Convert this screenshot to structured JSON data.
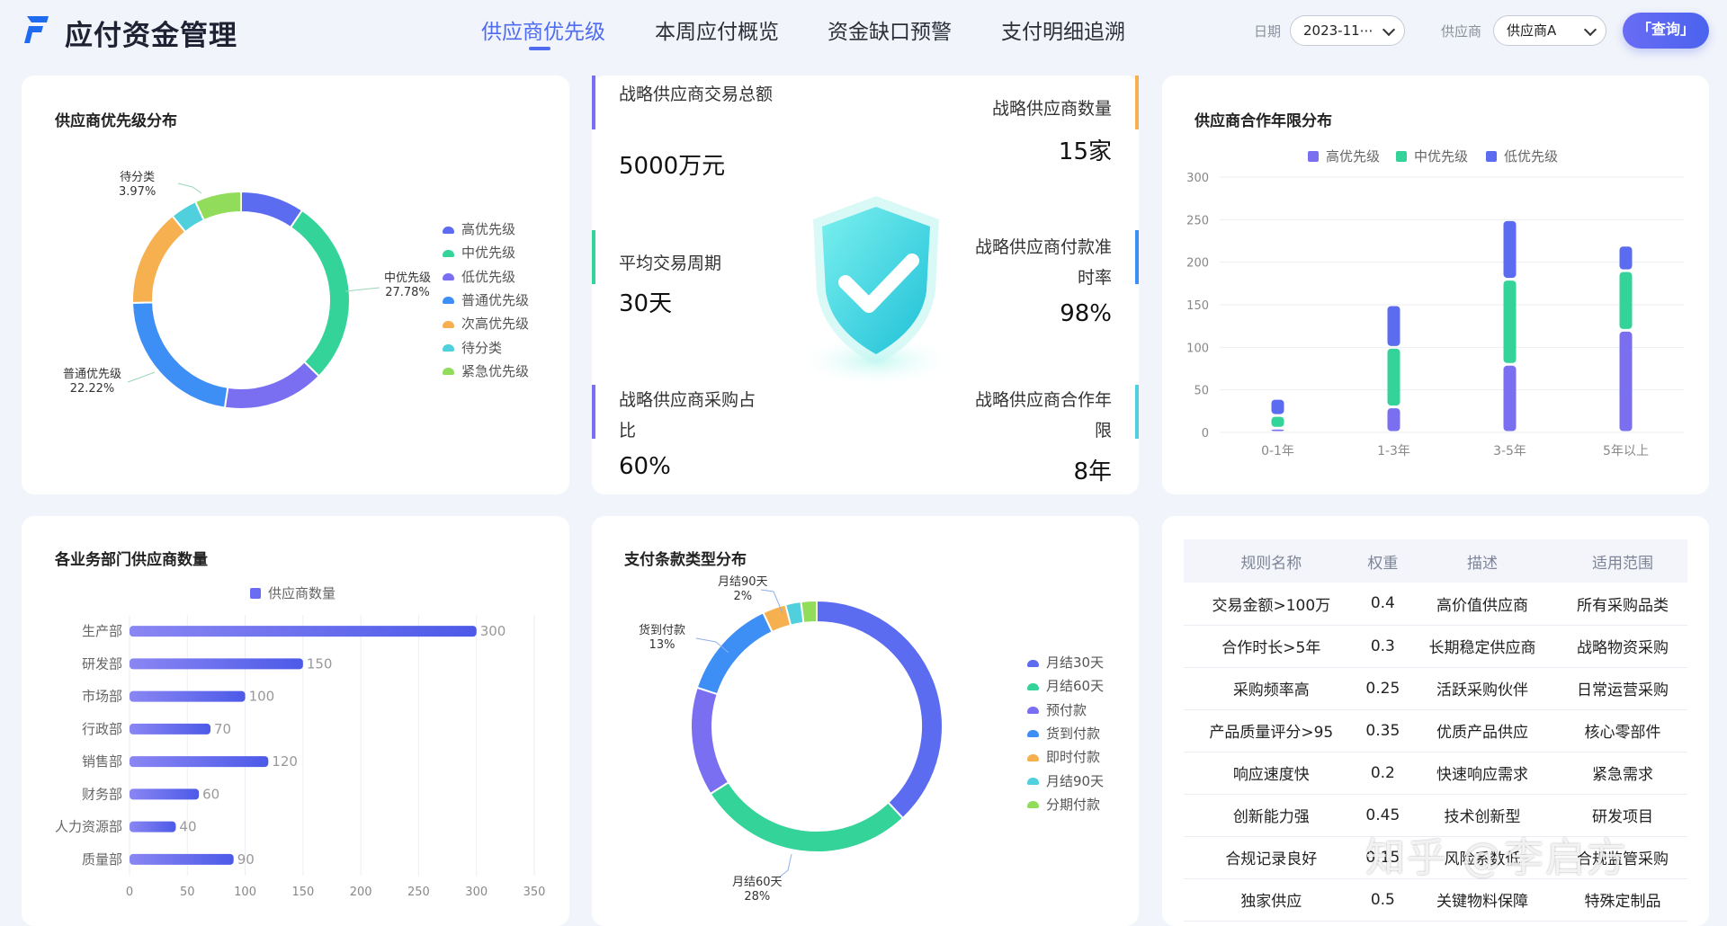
{
  "app": {
    "title": "应付资金管理"
  },
  "nav": {
    "tabs": [
      "供应商优先级",
      "本周应付概览",
      "资金缺口预警",
      "支付明细追溯"
    ],
    "active": 0
  },
  "filters": {
    "date_label": "日期",
    "date_value": "2023-11⋯",
    "supplier_label": "供应商",
    "supplier_value": "供应商A",
    "query_label": "「查询」"
  },
  "colors": {
    "accent": "#4f6bf0",
    "blue": "#5b6cf1",
    "green": "#34d399",
    "purple": "#7b6ff1",
    "lightblue": "#3d8ef5",
    "orange": "#f7b04f",
    "cyan": "#4fd0dc",
    "lime": "#92dc5c"
  },
  "priority_chart": {
    "title": "供应商优先级分布",
    "legend": [
      "高优先级",
      "中优先级",
      "低优先级",
      "普通优先级",
      "次高优先级",
      "待分类",
      "紧急优先级"
    ],
    "slice_labels": [
      {
        "name": "待分类",
        "pct": "3.97%"
      },
      {
        "name": "中优先级",
        "pct": "27.78%"
      },
      {
        "name": "普通优先级",
        "pct": "22.22%"
      }
    ]
  },
  "kpis": [
    {
      "label": "战略供应商交易总额",
      "value": "5000万元"
    },
    {
      "label": "战略供应商数量",
      "value": "15家"
    },
    {
      "label": "平均交易周期",
      "value": "30天"
    },
    {
      "label": "战略供应商付款准时率",
      "value": "98%"
    },
    {
      "label": "战略供应商采购占比",
      "value": "60%"
    },
    {
      "label": "战略供应商合作年限",
      "value": "8年"
    }
  ],
  "coop_chart": {
    "title": "供应商合作年限分布"
  },
  "dept_chart": {
    "title": "各业务部门供应商数量"
  },
  "terms_chart": {
    "title": "支付条款类型分布",
    "legend": [
      "月结30天",
      "月结60天",
      "预付款",
      "货到付款",
      "即时付款",
      "月结90天",
      "分期付款"
    ],
    "slice_labels": [
      {
        "name": "月结90天",
        "pct": "2%"
      },
      {
        "name": "货到付款",
        "pct": "13%"
      },
      {
        "name": "月结60天",
        "pct": "28%"
      }
    ]
  },
  "rules_table": {
    "headers": [
      "规则名称",
      "权重",
      "描述",
      "适用范围"
    ],
    "rows": [
      [
        "交易金额>100万",
        "0.4",
        "高价值供应商",
        "所有采购品类"
      ],
      [
        "合作时长>5年",
        "0.3",
        "长期稳定供应商",
        "战略物资采购"
      ],
      [
        "采购频率高",
        "0.25",
        "活跃采购伙伴",
        "日常运营采购"
      ],
      [
        "产品质量评分>95",
        "0.35",
        "优质产品供应",
        "核心零部件"
      ],
      [
        "响应速度快",
        "0.2",
        "快速响应需求",
        "紧急需求"
      ],
      [
        "创新能力强",
        "0.45",
        "技术创新型",
        "研发项目"
      ],
      [
        "合规记录良好",
        "0.15",
        "风险系数低",
        "合规监管采购"
      ],
      [
        "独家供应",
        "0.5",
        "关键物料保障",
        "特殊定制品"
      ]
    ]
  },
  "watermark": "知乎 @李启方",
  "chart_data": [
    {
      "type": "pie",
      "labels": [
        "高优先级",
        "中优先级",
        "低优先级",
        "普通优先级",
        "次高优先级",
        "待分类",
        "紧急优先级"
      ],
      "values": [
        9.5,
        27.78,
        15.1,
        22.22,
        14.5,
        3.97,
        6.9
      ]
    },
    {
      "type": "bar",
      "stacked": true,
      "categories": [
        "0-1年",
        "1-3年",
        "3-5年",
        "5年以上"
      ],
      "series": [
        {
          "name": "高优先级",
          "values": [
            20,
            50,
            70,
            30
          ]
        },
        {
          "name": "中优先级",
          "values": [
            15,
            70,
            100,
            70
          ]
        },
        {
          "name": "低优先级",
          "values": [
            5,
            30,
            80,
            120
          ]
        }
      ],
      "ylim": [
        0,
        300
      ],
      "yticks": [
        0,
        50,
        100,
        150,
        200,
        250,
        300
      ],
      "legend_position": "top"
    },
    {
      "type": "bar",
      "orientation": "horizontal",
      "categories": [
        "生产部",
        "研发部",
        "市场部",
        "行政部",
        "销售部",
        "财务部",
        "人力资源部",
        "质量部"
      ],
      "series": [
        {
          "name": "供应商数量",
          "values": [
            300,
            150,
            100,
            70,
            120,
            60,
            40,
            90
          ]
        }
      ],
      "xlim": [
        0,
        350
      ],
      "xticks": [
        0,
        50,
        100,
        150,
        200,
        250,
        300,
        350
      ],
      "legend_position": "top"
    },
    {
      "type": "pie",
      "labels": [
        "月结30天",
        "月结60天",
        "预付款",
        "货到付款",
        "即时付款",
        "月结90天",
        "分期付款"
      ],
      "values": [
        38,
        28,
        14,
        13,
        3,
        2,
        2
      ]
    }
  ]
}
